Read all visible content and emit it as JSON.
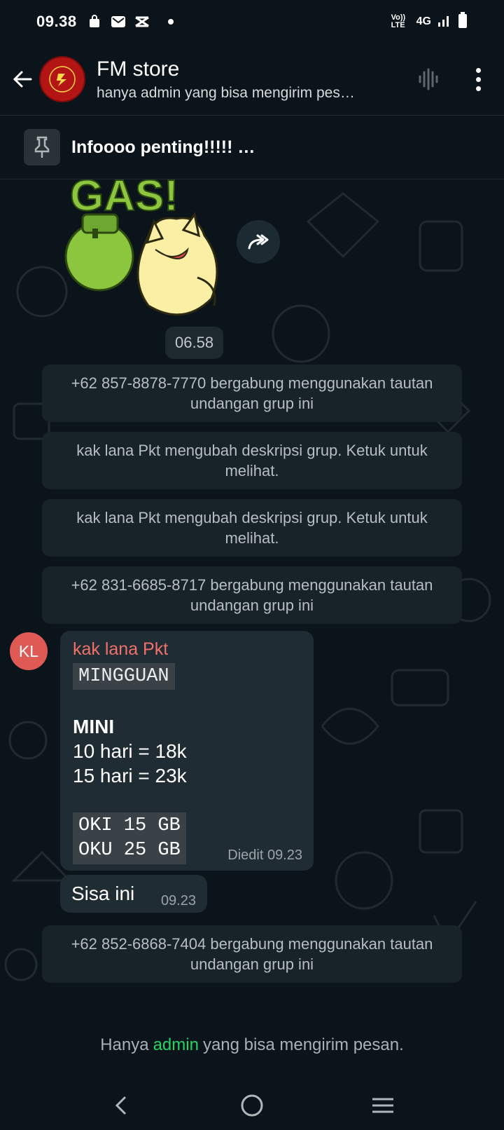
{
  "status_bar": {
    "time": "09.38",
    "network": "4G",
    "volte": "Vo)) LTE"
  },
  "header": {
    "title": "FM store",
    "subtitle": "hanya admin yang bisa mengirim pes…",
    "icons": [
      "arrow-back-icon",
      "voice-wave-icon",
      "more-vert-icon"
    ]
  },
  "pinned": {
    "text": "Infoooo penting!!!!! …"
  },
  "chat": {
    "sticker_time": "06.58",
    "system_messages": [
      "+62 857-8878-7770 bergabung menggunakan tautan undangan grup ini",
      "kak lana Pkt mengubah deskripsi grup. Ketuk untuk melihat.",
      "kak lana Pkt mengubah deskripsi grup. Ketuk untuk melihat.",
      "+62 831-6685-8717 bergabung menggunakan tautan undangan grup ini",
      "+62 852-6868-7404 bergabung menggunakan tautan undangan grup ini"
    ],
    "message": {
      "avatar_initials": "KL",
      "sender": "kak lana Pkt",
      "heading_mono": "MINGGUAN",
      "title": "MINI",
      "line1": "10 hari = 18k",
      "line2": "15 hari = 23k",
      "mono_line1": "OKI 15 GB",
      "mono_line2": "OKU 25 GB",
      "meta": "Diedit 09.23"
    },
    "message2": {
      "text": "Sisa ini",
      "time": "09.23"
    }
  },
  "footer": {
    "prefix": "Hanya",
    "link": "admin",
    "suffix": "yang bisa mengirim pesan."
  },
  "colors": {
    "background": "#0b141a",
    "bubble": "#202c33",
    "system_bubble": "#182229",
    "sender_name": "#f1706a",
    "link_green": "#25d366"
  }
}
